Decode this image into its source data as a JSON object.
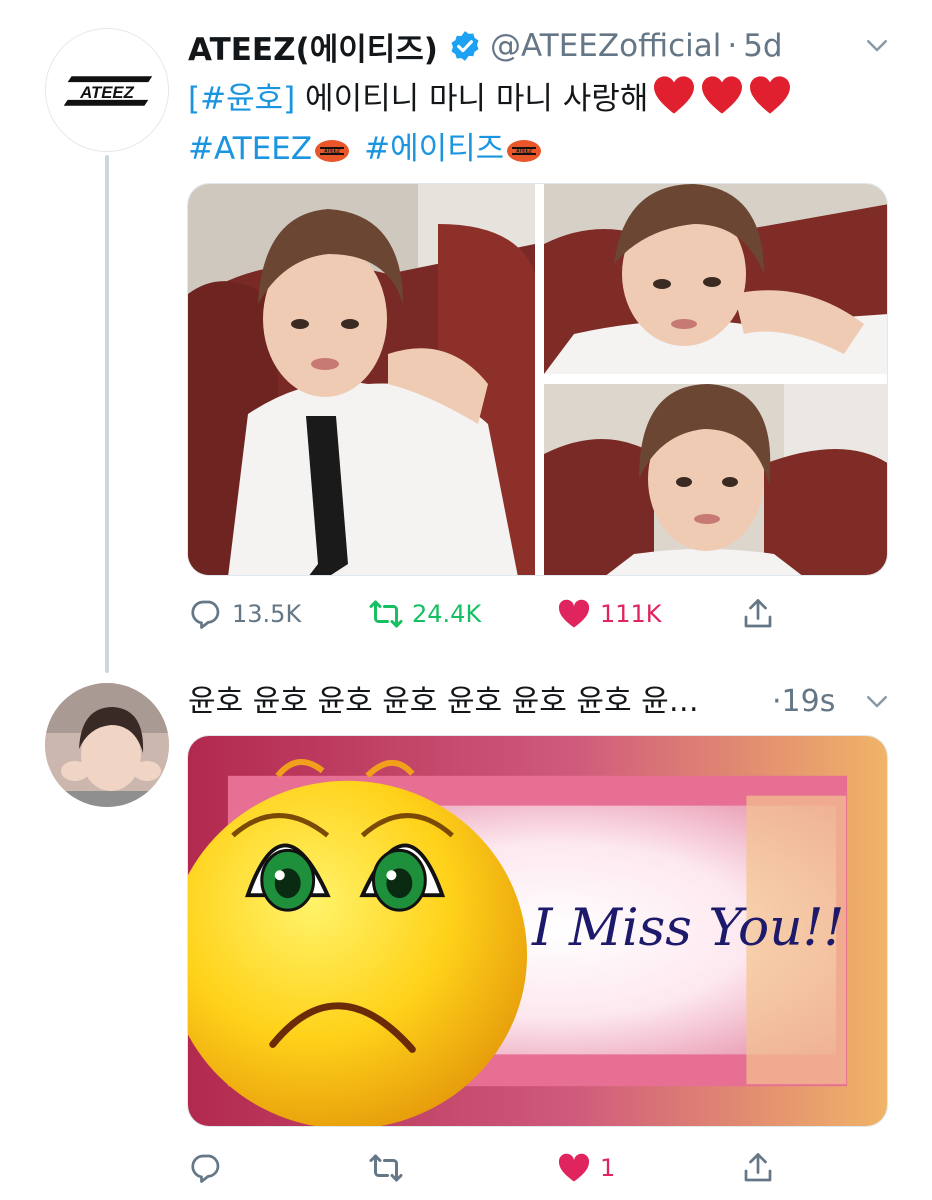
{
  "tweet": {
    "author_name": "ATEEZ(에이티즈)",
    "handle": "@ATEEZofficial",
    "separator": "·",
    "time": "5d",
    "avatar_logo_text": "ATEEZ",
    "text_hashtag": "[#윤호]",
    "text_body": " 에이티니 마니 마니 사랑해",
    "hashtag_1": "#ATEEZ",
    "hashtag_2": "#에이티즈",
    "emoji_badge_text": "ATEEZ",
    "actions": {
      "replies": "13.5K",
      "retweets": "24.4K",
      "likes": "111K"
    }
  },
  "reply": {
    "text": "윤호 윤호 윤호 윤호 윤호 윤호 윤호 윤…",
    "time": "·19s",
    "image_text": "I Miss You!!",
    "actions": {
      "likes": "1"
    }
  },
  "colors": {
    "link": "#1b95e0",
    "retweet": "#17bf63",
    "like": "#e0245e",
    "muted": "#657786",
    "thread_line": "#ccd6dd"
  },
  "icons": [
    "verified-badge-icon",
    "chevron-down-icon",
    "reply-icon",
    "retweet-icon",
    "like-icon",
    "share-icon"
  ]
}
